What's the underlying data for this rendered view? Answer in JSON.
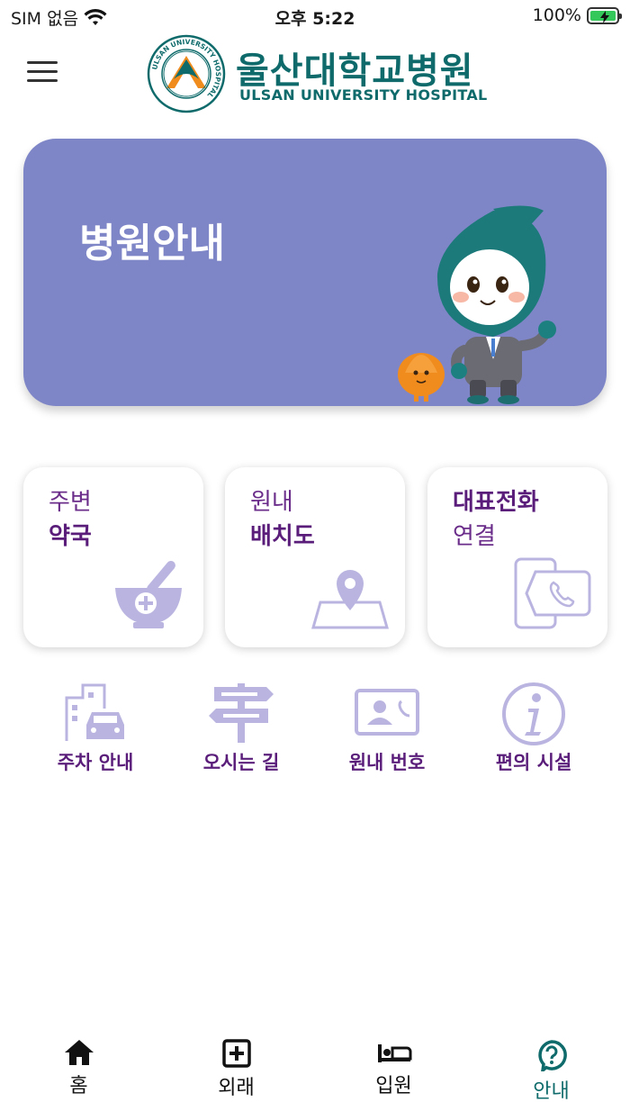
{
  "status_bar": {
    "carrier": "SIM 없음",
    "time": "오후 5:22",
    "battery": "100%",
    "battery_level": 1.0
  },
  "header": {
    "logo_name_ko": "울산대학교병원",
    "logo_name_en": "ULSAN UNIVERSITY HOSPITAL",
    "emblem_ring_text": "ULSAN UNIVERSITY HOSPITAL",
    "emblem_inner_text": "울산대학교병원"
  },
  "hero": {
    "title": "병원안내"
  },
  "cards": [
    {
      "line1": "주변",
      "line2": "약국",
      "bold": "line2",
      "icon": "mortar-pestle-icon"
    },
    {
      "line1": "원내",
      "line2": "배치도",
      "bold": "line2",
      "icon": "map-pin-icon"
    },
    {
      "line1": "대표전화",
      "line2": "연결",
      "bold": "line1",
      "icon": "phone-call-icon"
    }
  ],
  "quick_menu": [
    {
      "label": "주차 안내",
      "icon": "parking-car-icon"
    },
    {
      "label": "오시는 길",
      "icon": "signpost-icon"
    },
    {
      "label": "원내 번호",
      "icon": "contact-card-icon"
    },
    {
      "label": "편의 시설",
      "icon": "info-icon"
    }
  ],
  "tab_bar": {
    "tabs": [
      {
        "label": "홈",
        "icon": "home-icon",
        "active": false
      },
      {
        "label": "외래",
        "icon": "plus-square-icon",
        "active": false
      },
      {
        "label": "입원",
        "icon": "bed-icon",
        "active": false
      },
      {
        "label": "안내",
        "icon": "question-bubble-icon",
        "active": true
      }
    ],
    "active_color": "#0f6b6b"
  },
  "colors": {
    "brand_teal": "#0f6b6b",
    "hero_bg": "#7f86c7",
    "card_text": "#5a1e7a",
    "icon_lavender": "#b9b5e0"
  }
}
